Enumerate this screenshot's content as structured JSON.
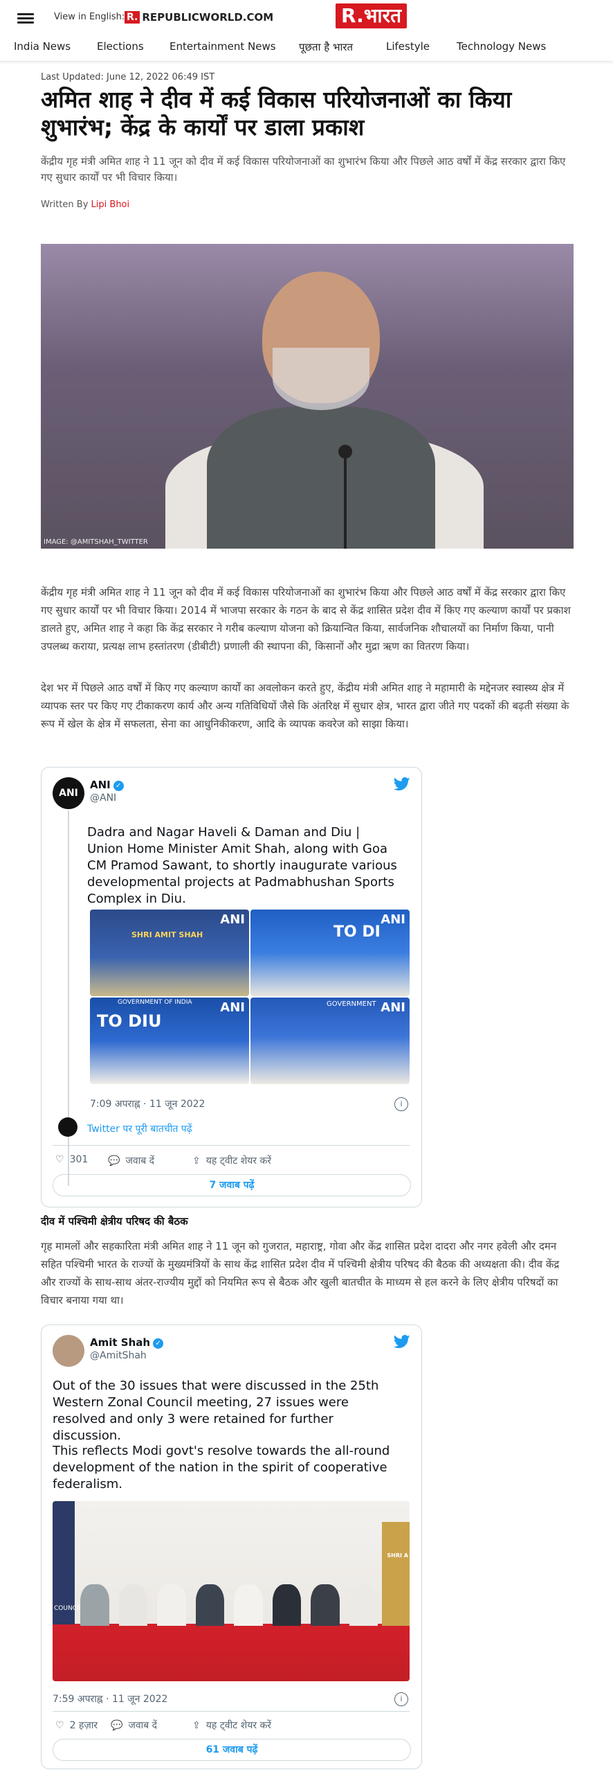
{
  "header": {
    "view_in_english": "View in English:",
    "rw_r": "R.",
    "rw_name": "REPUBLICWORLD.COM",
    "bharat_logo": "R.भारत",
    "nav": [
      "India News",
      "Elections",
      "Entertainment News",
      "पूछता है भारत",
      "Lifestyle",
      "Technology News"
    ]
  },
  "article": {
    "updated": "Last Updated: June 12, 2022 06:49 IST",
    "headline": "अमित शाह ने दीव में कई विकास परियोजनाओं का किया शुभारंभ; केंद्र के कार्यों पर डाला प्रकाश",
    "summary": "केंद्रीय गृह मंत्री अमित शाह ने 11 जून को दीव में कई विकास परियोजनाओं का शुभारंभ किया और पिछले आठ वर्षों में केंद्र सरकार द्वारा किए गए सुधार कार्यों पर भी विचार किया।",
    "written_by": "Written By",
    "author": "Lipi Bhoi",
    "image_caption": "IMAGE: @AMITSHAH_TWITTER",
    "para1": "केंद्रीय गृह मंत्री अमित शाह ने 11 जून को दीव में कई विकास परियोजनाओं का शुभारंभ किया और पिछले आठ वर्षों में केंद्र सरकार द्वारा किए गए सुधार कार्यों पर भी विचार किया। 2014 में भाजपा सरकार के गठन के बाद से केंद्र शासित प्रदेश दीव में किए गए कल्याण कार्यों पर प्रकाश डालते हुए, अमित शाह ने कहा कि केंद्र सरकार ने गरीब कल्याण योजना को क्रियान्वित किया, सार्वजनिक शौचालयों का निर्माण किया, पानी उपलब्ध कराया, प्रत्यक्ष लाभ हस्तांतरण (डीबीटी) प्रणाली की स्थापना की, किसानों और मुद्रा ऋण का वितरण किया।",
    "para2": "देश भर में पिछले आठ वर्षों में किए गए कल्याण कार्यों का अवलोकन करते हुए, केंद्रीय मंत्री अमित शाह ने महामारी के मद्देनजर स्वास्थ्य क्षेत्र में व्यापक स्तर पर किए गए टीकाकरण कार्य और अन्य गतिविधियों जैसे कि अंतरिक्ष में सुधार क्षेत्र, भारत द्वारा जीते गए पदकों की बढ़ती संख्या के रूप में खेल के क्षेत्र में सफलता, सेना का आधुनिकीकरण, आदि के व्यापक कवरेज को साझा किया।",
    "section_heading": "दीव में पश्चिमी क्षेत्रीय परिषद की बैठक",
    "para3": "गृह मामलों और सहकारिता मंत्री अमित शाह ने 11 जून को गुजरात, महाराष्ट्र, गोवा और केंद्र शासित प्रदेश दादरा और नगर हवेली और दमन सहित पश्चिमी भारत के राज्यों के मुख्यमंत्रियों के साथ केंद्र शासित प्रदेश दीव में पश्चिमी क्षेत्रीय परिषद की बैठक की अध्यक्षता की। दीव केंद्र और राज्यों के साथ-साथ अंतर-राज्यीय मुद्दों को नियमित रूप से बैठक और खुली बातचीत के माध्यम से हल करने के लिए क्षेत्रीय परिषदों का विचार बनाया गया था।"
  },
  "tweet1": {
    "avatar": "ANI",
    "name": "ANI",
    "handle": "@ANI",
    "text": "Dadra and Nagar Haveli & Daman and Diu | Union Home Minister Amit Shah, along with Goa CM Pramod Sawant, to shortly inaugurate various developmental projects at Padmabhushan Sports Complex in Diu.",
    "img_tag": "ANI",
    "img_texts": [
      "SHRI AMIT SHAH",
      "TO DI",
      "GOVERNMENT OF INDIA",
      "TO DIU",
      "GOVERNMENT"
    ],
    "time": "7:09 अपराह्न · 11 जून 2022",
    "thread": "Twitter पर पूरी बातचीत पढ़ें",
    "likes": "301",
    "reply": "जवाब दें",
    "share": "यह ट्वीट शेयर करें",
    "replies": "7 जवाब पढ़ें"
  },
  "tweet2": {
    "name": "Amit Shah",
    "handle": "@AmitShah",
    "text1": "Out of the 30 issues that were discussed in the 25th Western Zonal Council meeting, 27 issues were resolved and only 3 were retained for further discussion.",
    "text2": "This reflects Modi govt's resolve towards the all-round development of the nation in the spirit of cooperative federalism.",
    "banner_text": "COUNCIL",
    "banner_right": "SHRI A",
    "time": "7:59 अपराह्न · 11 जून 2022",
    "likes": "2 हज़ार",
    "reply": "जवाब दें",
    "share": "यह ट्वीट शेयर करें",
    "replies": "61 जवाब पढ़ें"
  },
  "colors": {
    "brand_red": "#d71920",
    "twitter_blue": "#1d9bf0"
  }
}
